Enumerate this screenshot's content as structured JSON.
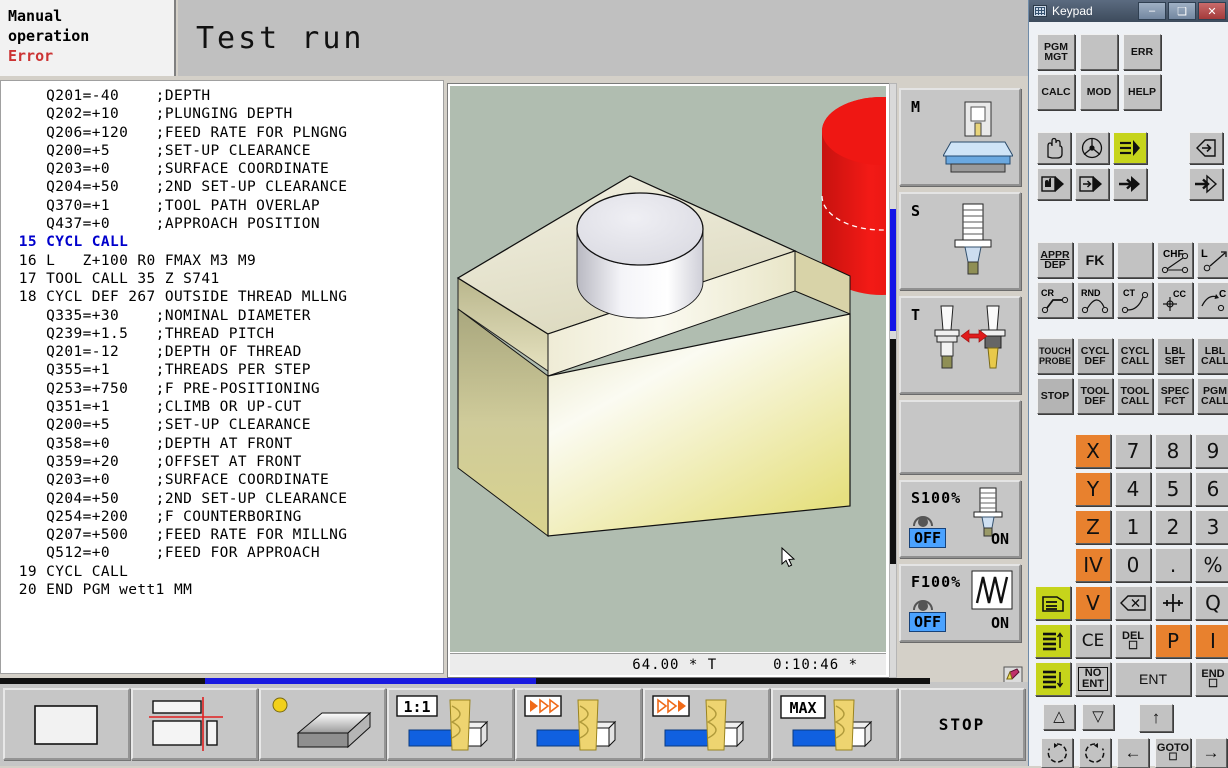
{
  "header": {
    "mode_line1": "Manual",
    "mode_line2": "operation",
    "status": "Error",
    "title": "Test run"
  },
  "program": {
    "lines": [
      {
        "num": "",
        "text": "Q201=-40    ;DEPTH",
        "hl": false
      },
      {
        "num": "",
        "text": "Q202=+10    ;PLUNGING DEPTH",
        "hl": false
      },
      {
        "num": "",
        "text": "Q206=+120   ;FEED RATE FOR PLNGNG",
        "hl": false
      },
      {
        "num": "",
        "text": "Q200=+5     ;SET-UP CLEARANCE",
        "hl": false
      },
      {
        "num": "",
        "text": "Q203=+0     ;SURFACE COORDINATE",
        "hl": false
      },
      {
        "num": "",
        "text": "Q204=+50    ;2ND SET-UP CLEARANCE",
        "hl": false
      },
      {
        "num": "",
        "text": "Q370=+1     ;TOOL PATH OVERLAP",
        "hl": false
      },
      {
        "num": "",
        "text": "Q437=+0     ;APPROACH POSITION",
        "hl": false
      },
      {
        "num": "15",
        "text": "CYCL CALL",
        "hl": true
      },
      {
        "num": "16",
        "text": "L   Z+100 R0 FMAX M3 M9",
        "hl": false
      },
      {
        "num": "17",
        "text": "TOOL CALL 35 Z S741",
        "hl": false
      },
      {
        "num": "18",
        "text": "CYCL DEF 267 OUTSIDE THREAD MLLNG",
        "hl": false
      },
      {
        "num": "",
        "text": "Q335=+30    ;NOMINAL DIAMETER",
        "hl": false
      },
      {
        "num": "",
        "text": "Q239=+1.5   ;THREAD PITCH",
        "hl": false
      },
      {
        "num": "",
        "text": "Q201=-12    ;DEPTH OF THREAD",
        "hl": false
      },
      {
        "num": "",
        "text": "Q355=+1     ;THREADS PER STEP",
        "hl": false
      },
      {
        "num": "",
        "text": "Q253=+750   ;F PRE-POSITIONING",
        "hl": false
      },
      {
        "num": "",
        "text": "Q351=+1     ;CLIMB OR UP-CUT",
        "hl": false
      },
      {
        "num": "",
        "text": "Q200=+5     ;SET-UP CLEARANCE",
        "hl": false
      },
      {
        "num": "",
        "text": "Q358=+0     ;DEPTH AT FRONT",
        "hl": false
      },
      {
        "num": "",
        "text": "Q359=+20    ;OFFSET AT FRONT",
        "hl": false
      },
      {
        "num": "",
        "text": "Q203=+0     ;SURFACE COORDINATE",
        "hl": false
      },
      {
        "num": "",
        "text": "Q204=+50    ;2ND SET-UP CLEARANCE",
        "hl": false
      },
      {
        "num": "",
        "text": "Q254=+200   ;F COUNTERBORING",
        "hl": false
      },
      {
        "num": "",
        "text": "Q207=+500   ;FEED RATE FOR MILLNG",
        "hl": false
      },
      {
        "num": "",
        "text": "Q512=+0     ;FEED FOR APPROACH",
        "hl": false
      },
      {
        "num": "19",
        "text": "CYCL CALL",
        "hl": false
      },
      {
        "num": "20",
        "text": "END PGM wett1 MM",
        "hl": false
      }
    ]
  },
  "graphics": {
    "status_value": "64.00  *  T",
    "status_time": "0:10:46  *",
    "background_color": "#b0bdb0",
    "workpiece_color": "#ede7bd",
    "boss_color": "#e3e3ea",
    "cylinder_color": "#e8201c"
  },
  "status_column": {
    "m_label": "M",
    "s_label": "S",
    "t_label": "T",
    "spindle_override": {
      "label": "S100%",
      "off": "OFF",
      "on": "ON"
    },
    "feed_override": {
      "label": "F100%",
      "off": "OFF",
      "on": "ON"
    }
  },
  "softkeys": [
    {
      "name": "blank-view",
      "label": "",
      "icon": "rect-frame"
    },
    {
      "name": "split-view",
      "label": "",
      "icon": "split-frame"
    },
    {
      "name": "solid-model-view",
      "label": "",
      "icon": "solid-block"
    },
    {
      "name": "scale-1-1",
      "label": "1:1",
      "icon": "tool-mill"
    },
    {
      "name": "single-step-run",
      "label": "",
      "icon": "tool-mill-arrows-1"
    },
    {
      "name": "fast-run",
      "label": "",
      "icon": "tool-mill-arrows-2"
    },
    {
      "name": "max-speed-run",
      "label": "MAX",
      "icon": "tool-mill-max"
    },
    {
      "name": "stop",
      "label": "STOP",
      "icon": ""
    }
  ],
  "keypad": {
    "window_title": "Keypad",
    "window_buttons": {
      "minimize": "–",
      "maximize": "❑",
      "close": "✕"
    },
    "row_pgm": [
      {
        "name": "pgm-mgt-key",
        "l1": "PGM",
        "l2": "MGT"
      },
      {
        "name": "blank-key-1",
        "l1": "",
        "l2": ""
      },
      {
        "name": "err-key",
        "l1": "ERR",
        "l2": ""
      }
    ],
    "row_calc": [
      {
        "name": "calc-key",
        "l1": "CALC",
        "l2": ""
      },
      {
        "name": "mod-key",
        "l1": "MOD",
        "l2": ""
      },
      {
        "name": "help-key",
        "l1": "HELP",
        "l2": ""
      }
    ],
    "mode_keys_row1": [
      "manual-hand-key",
      "handwheel-key",
      "program-run-key",
      "program-enter-key"
    ],
    "mode_keys_row2": [
      "single-block-key",
      "block-scan-key",
      "program-run-full-key",
      "mdi-key"
    ],
    "path_keys_row1": [
      {
        "name": "appr-dep-key",
        "l1": "APPR",
        "l2": "DEP"
      },
      {
        "name": "fk-key",
        "l1": "FK",
        "l2": ""
      },
      {
        "name": "blank-key-2",
        "l1": "",
        "l2": ""
      },
      {
        "name": "chf-key",
        "l1": "CHF",
        "l2": ""
      },
      {
        "name": "line-key",
        "l1": "L",
        "l2": ""
      }
    ],
    "path_keys_row2": [
      {
        "name": "cr-key",
        "l1": "CR",
        "l2": ""
      },
      {
        "name": "rnd-key",
        "l1": "RND",
        "l2": ""
      },
      {
        "name": "ct-key",
        "l1": "CT",
        "l2": ""
      },
      {
        "name": "cc-key",
        "l1": "CC",
        "l2": ""
      },
      {
        "name": "c-key",
        "l1": "C",
        "l2": ""
      }
    ],
    "cycle_keys_row1": [
      {
        "name": "touch-probe-key",
        "l1": "TOUCH",
        "l2": "PROBE"
      },
      {
        "name": "cycl-def-key",
        "l1": "CYCL",
        "l2": "DEF"
      },
      {
        "name": "cycl-call-key",
        "l1": "CYCL",
        "l2": "CALL"
      },
      {
        "name": "lbl-set-key",
        "l1": "LBL",
        "l2": "SET"
      },
      {
        "name": "lbl-call-key",
        "l1": "LBL",
        "l2": "CALL"
      }
    ],
    "cycle_keys_row2": [
      {
        "name": "stop-key",
        "l1": "STOP",
        "l2": ""
      },
      {
        "name": "tool-def-key",
        "l1": "TOOL",
        "l2": "DEF"
      },
      {
        "name": "tool-call-key",
        "l1": "TOOL",
        "l2": "CALL"
      },
      {
        "name": "spec-fct-key",
        "l1": "SPEC",
        "l2": "FCT"
      },
      {
        "name": "pgm-call-key",
        "l1": "PGM",
        "l2": "CALL"
      }
    ],
    "numeric": [
      {
        "name": "axis-x-key",
        "label": "X",
        "color": "orange"
      },
      {
        "name": "digit-7-key",
        "label": "7",
        "color": "grey"
      },
      {
        "name": "digit-8-key",
        "label": "8",
        "color": "grey"
      },
      {
        "name": "digit-9-key",
        "label": "9",
        "color": "grey"
      },
      {
        "name": "axis-y-key",
        "label": "Y",
        "color": "orange"
      },
      {
        "name": "digit-4-key",
        "label": "4",
        "color": "grey"
      },
      {
        "name": "digit-5-key",
        "label": "5",
        "color": "grey"
      },
      {
        "name": "digit-6-key",
        "label": "6",
        "color": "grey"
      },
      {
        "name": "axis-z-key",
        "label": "Z",
        "color": "orange"
      },
      {
        "name": "digit-1-key",
        "label": "1",
        "color": "grey"
      },
      {
        "name": "digit-2-key",
        "label": "2",
        "color": "grey"
      },
      {
        "name": "digit-3-key",
        "label": "3",
        "color": "grey"
      },
      {
        "name": "axis-iv-key",
        "label": "IV",
        "color": "orange"
      },
      {
        "name": "digit-0-key",
        "label": "0",
        "color": "grey"
      },
      {
        "name": "decimal-point-key",
        "label": ".",
        "color": "grey"
      },
      {
        "name": "sign-toggle-key",
        "label": "%",
        "color": "grey"
      }
    ],
    "row_v": [
      {
        "name": "pgm-list-key",
        "label": "",
        "color": "green"
      },
      {
        "name": "axis-v-key",
        "label": "V",
        "color": "orange"
      },
      {
        "name": "backspace-key",
        "label": "",
        "color": "grey"
      },
      {
        "name": "actual-position-key",
        "label": "",
        "color": "grey"
      },
      {
        "name": "q-parameter-key",
        "label": "Q",
        "color": "grey"
      }
    ],
    "row_ce": [
      {
        "name": "page-up-key",
        "label": "",
        "color": "green"
      },
      {
        "name": "ce-key",
        "label": "CE",
        "color": "grey"
      },
      {
        "name": "del-key",
        "l1": "DEL",
        "label": "",
        "color": "grey"
      },
      {
        "name": "p-key",
        "label": "P",
        "color": "orange"
      },
      {
        "name": "i-key",
        "label": "I",
        "color": "orange"
      }
    ],
    "row_ent": [
      {
        "name": "page-down-key",
        "label": "",
        "color": "green"
      },
      {
        "name": "no-ent-key",
        "l1": "NO",
        "l2": "ENT",
        "color": "grey"
      },
      {
        "name": "ent-key",
        "label": "ENT",
        "color": "grey"
      },
      {
        "name": "end-key",
        "l1": "END",
        "color": "grey"
      }
    ],
    "arrows": {
      "up-triangle-key": "△",
      "down-triangle-key": "▽",
      "arrow-up-key": "↑",
      "arrow-left-key": "←",
      "arrow-right-key": "→",
      "goto-key": "GOTO"
    }
  }
}
